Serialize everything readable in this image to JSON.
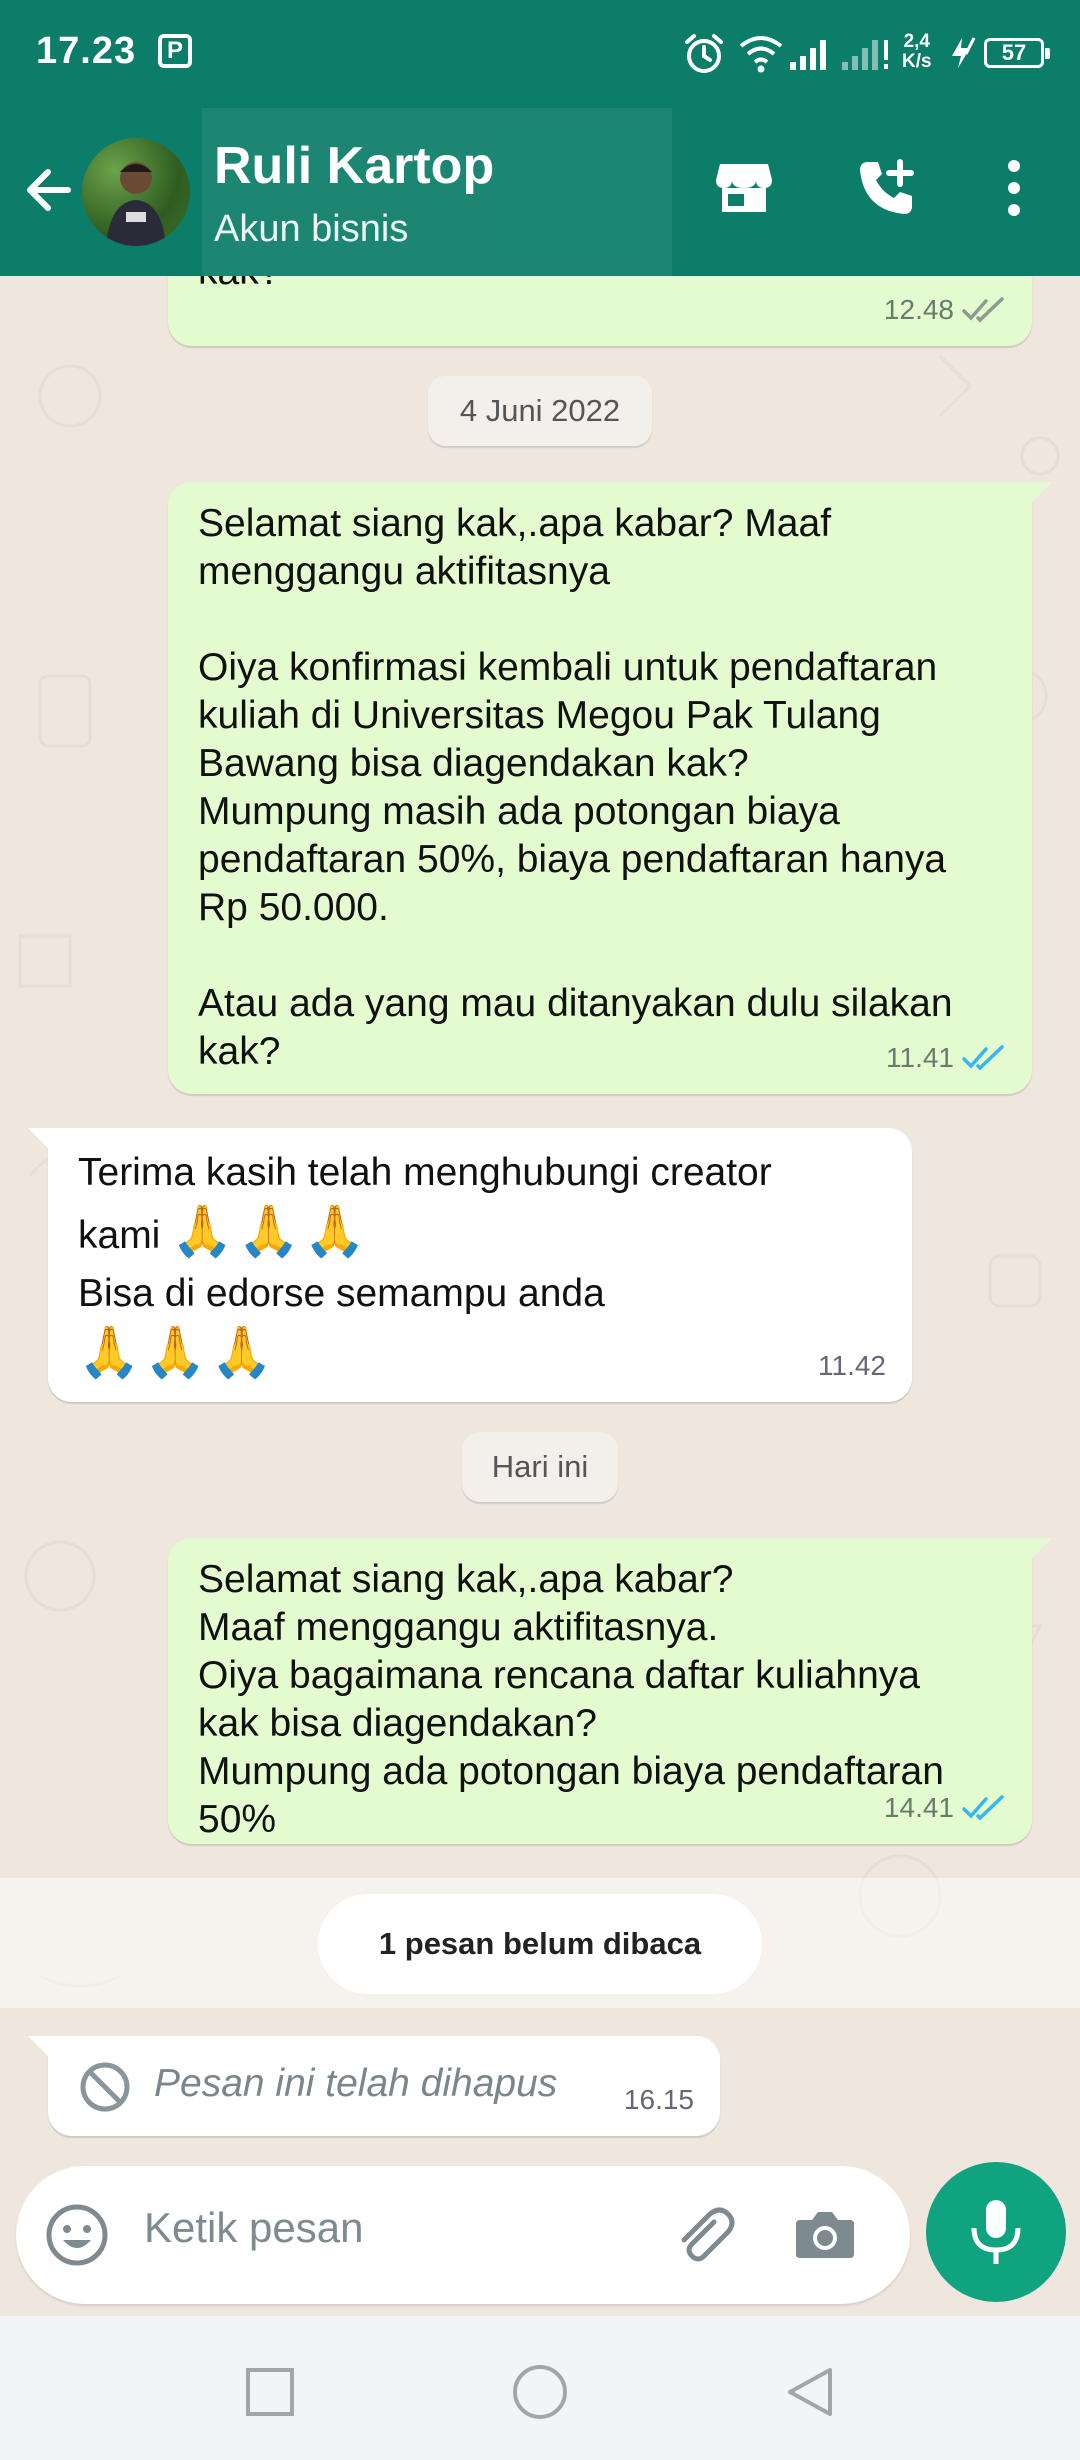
{
  "status_bar": {
    "time": "17.23",
    "net_speed_value": "2,4",
    "net_speed_unit": "K/s",
    "battery": "57",
    "icons": [
      "p-icon",
      "alarm-icon",
      "wifi-icon",
      "signal-icon",
      "signal-icon-2",
      "charging-icon",
      "battery-icon"
    ]
  },
  "header": {
    "contact_name": "Ruli Kartop",
    "contact_subtitle": "Akun bisnis",
    "icons": [
      "back-arrow-icon",
      "store-icon",
      "add-call-icon",
      "more-vert-icon"
    ]
  },
  "messages": [
    {
      "id": "m0",
      "direction": "out",
      "text": "kak?",
      "time": "12.48",
      "status": "delivered"
    },
    {
      "id": "d1",
      "type": "date",
      "text": "4 Juni 2022"
    },
    {
      "id": "m1",
      "direction": "out",
      "text": "Selamat siang kak,.apa kabar? Maaf\nmenggangu aktifitasnya\n\nOiya konfirmasi kembali untuk pendaftaran\nkuliah di Universitas Megou Pak Tulang\nBawang bisa diagendakan kak?\nMumpung masih ada potongan biaya\npendaftaran 50%, biaya pendaftaran hanya\nRp 50.000.\n\nAtau ada yang mau ditanyakan dulu silakan\nkak?",
      "time": "11.41",
      "status": "read"
    },
    {
      "id": "m2",
      "direction": "in",
      "line1": "Terima kasih telah menghubungi creator",
      "line2": "kami",
      "line3": "Bisa di edorse semampu anda",
      "emoji": "🙏🙏🙏",
      "time": "11.42"
    },
    {
      "id": "d2",
      "type": "date",
      "text": "Hari ini"
    },
    {
      "id": "m3",
      "direction": "out",
      "text": "Selamat siang kak,.apa kabar?\nMaaf menggangu aktifitasnya.\nOiya bagaimana rencana daftar kuliahnya\nkak bisa diagendakan?\nMumpung ada potongan biaya pendaftaran\n50%",
      "time": "14.41",
      "status": "read"
    },
    {
      "id": "u1",
      "type": "unread",
      "text": "1 pesan belum dibaca"
    },
    {
      "id": "m4",
      "direction": "in",
      "deleted": true,
      "text": "Pesan ini telah dihapus",
      "time": "16.15"
    }
  ],
  "composer": {
    "placeholder": "Ketik pesan",
    "icons": [
      "emoji-icon",
      "attach-icon",
      "camera-icon",
      "mic-icon"
    ]
  },
  "colors": {
    "header_bg": "#0B7D69",
    "chat_bg": "#EFE7DE",
    "outgoing_bubble": "#E3FBCF",
    "incoming_bubble": "#FFFFFF",
    "read_tick": "#34B7F1",
    "mic_button": "#10A37F"
  },
  "navbar": {
    "icons": [
      "recents-square-icon",
      "home-circle-icon",
      "back-triangle-icon"
    ]
  }
}
